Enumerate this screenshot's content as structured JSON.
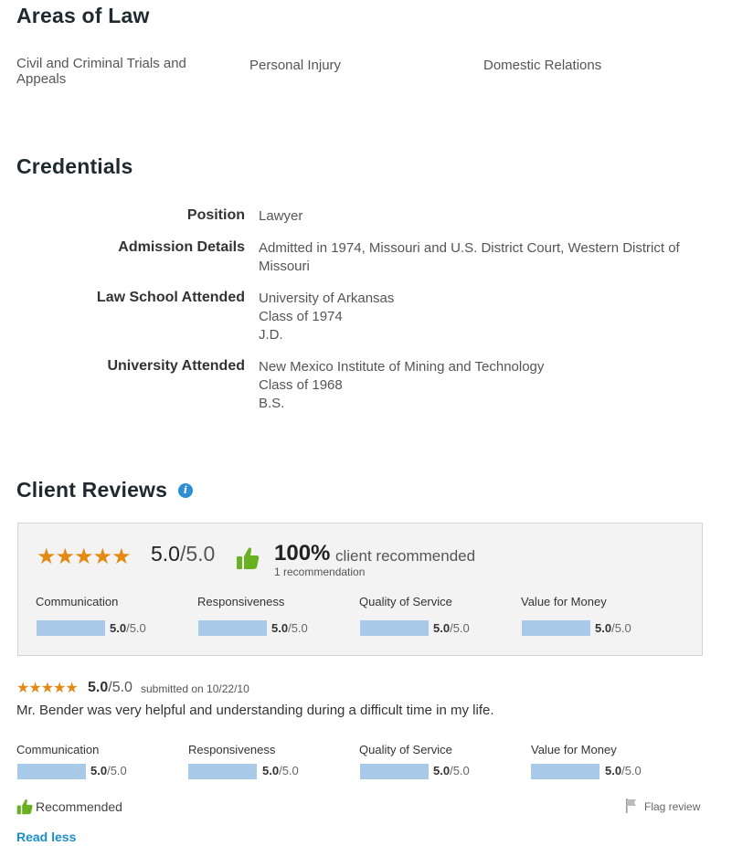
{
  "areas": {
    "title": "Areas of Law",
    "items": [
      "Civil and Criminal Trials and Appeals",
      "Personal Injury",
      "Domestic Relations"
    ]
  },
  "credentials": {
    "title": "Credentials",
    "rows": [
      {
        "label": "Position",
        "lines": [
          "Lawyer"
        ]
      },
      {
        "label": "Admission Details",
        "lines": [
          "Admitted in 1974, Missouri and U.S. District Court, Western District of Missouri"
        ]
      },
      {
        "label": "Law School Attended",
        "lines": [
          "University of Arkansas",
          "Class of 1974",
          "J.D."
        ]
      },
      {
        "label": "University Attended",
        "lines": [
          "New Mexico Institute of Mining and Technology",
          "Class of 1968",
          "B.S."
        ]
      }
    ]
  },
  "reviews": {
    "title": "Client Reviews",
    "info_icon": "info-icon",
    "summary": {
      "stars": "★★★★★",
      "score": "5.0",
      "score_den": "/5.0",
      "recommended_pct": "100%",
      "recommended_text": "client recommended",
      "recommendation_count": "1 recommendation",
      "categories": [
        {
          "label": "Communication",
          "score": "5.0",
          "den": "/5.0",
          "level": 1.0
        },
        {
          "label": "Responsiveness",
          "score": "5.0",
          "den": "/5.0",
          "level": 1.0
        },
        {
          "label": "Quality of Service",
          "score": "5.0",
          "den": "/5.0",
          "level": 1.0
        },
        {
          "label": "Value for Money",
          "score": "5.0",
          "den": "/5.0",
          "level": 1.0
        }
      ]
    },
    "review": {
      "stars": "★★★★★",
      "score": "5.0",
      "score_den": "/5.0",
      "date": "submitted on 10/22/10",
      "text": "Mr. Bender was very helpful and understanding during a difficult time in my life.",
      "categories": [
        {
          "label": "Communication",
          "score": "5.0",
          "den": "/5.0",
          "level": 1.0
        },
        {
          "label": "Responsiveness",
          "score": "5.0",
          "den": "/5.0",
          "level": 1.0
        },
        {
          "label": "Quality of Service",
          "score": "5.0",
          "den": "/5.0",
          "level": 1.0
        },
        {
          "label": "Value for Money",
          "score": "5.0",
          "den": "/5.0",
          "level": 1.0
        }
      ],
      "recommended_label": "Recommended",
      "flag_label": "Flag review",
      "read_less": "Read less"
    },
    "colors": {
      "star": "#e38a15",
      "thumb": "#6ab023",
      "bar": "#a9c9e8",
      "link": "#1a8fc9",
      "info": "#2b8fd6"
    }
  }
}
